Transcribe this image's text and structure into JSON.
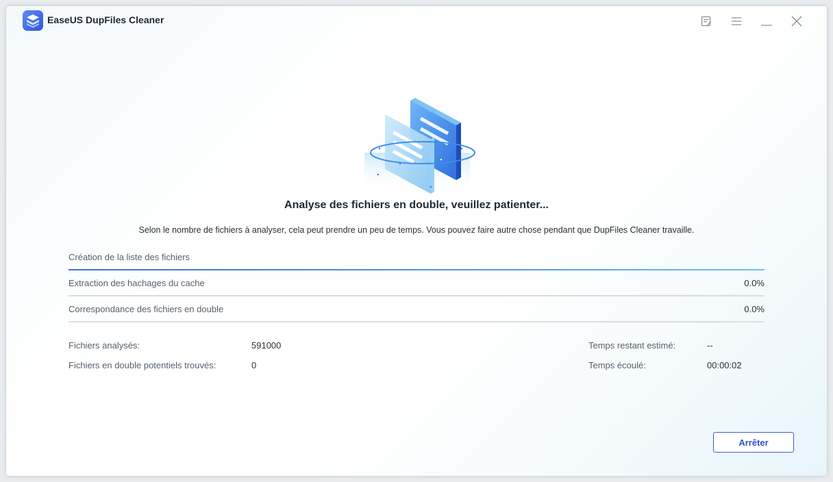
{
  "app": {
    "title": "EaseUS DupFiles Cleaner"
  },
  "icons": {
    "logo": "easeus-logo-icon",
    "feedback": "feedback-icon",
    "menu": "hamburger-menu-icon",
    "minimize": "minimize-icon",
    "close": "close-icon",
    "illustration": "duplicate-files-scan-icon"
  },
  "main": {
    "headline": "Analyse des fichiers en double, veuillez patienter...",
    "subline": "Selon le nombre de fichiers à analyser, cela peut prendre un peu de temps. Vous pouvez faire autre chose pendant que DupFiles Cleaner travaille."
  },
  "steps": [
    {
      "label": "Création de la liste des fichiers",
      "percent": "",
      "progress": 1.0
    },
    {
      "label": "Extraction des hachages du cache",
      "percent": "0.0%",
      "progress": 0.0
    },
    {
      "label": "Correspondance des fichiers en double",
      "percent": "0.0%",
      "progress": 0.0
    }
  ],
  "stats": {
    "files_scanned_label": "Fichiers analysés:",
    "files_scanned_value": "591000",
    "duplicates_found_label": "Fichiers en double potentiels trouvés:",
    "duplicates_found_value": "0",
    "time_remaining_label": "Temps restant estimé:",
    "time_remaining_value": "--",
    "time_elapsed_label": "Temps écoulé:",
    "time_elapsed_value": "00:00:02"
  },
  "actions": {
    "stop_label": "Arrêter"
  },
  "colors": {
    "accent": "#3c5bd3",
    "progress_start": "#3b6fe0",
    "progress_end": "#67c4ee",
    "text_primary": "#1f2933",
    "text_secondary": "#55606b"
  }
}
